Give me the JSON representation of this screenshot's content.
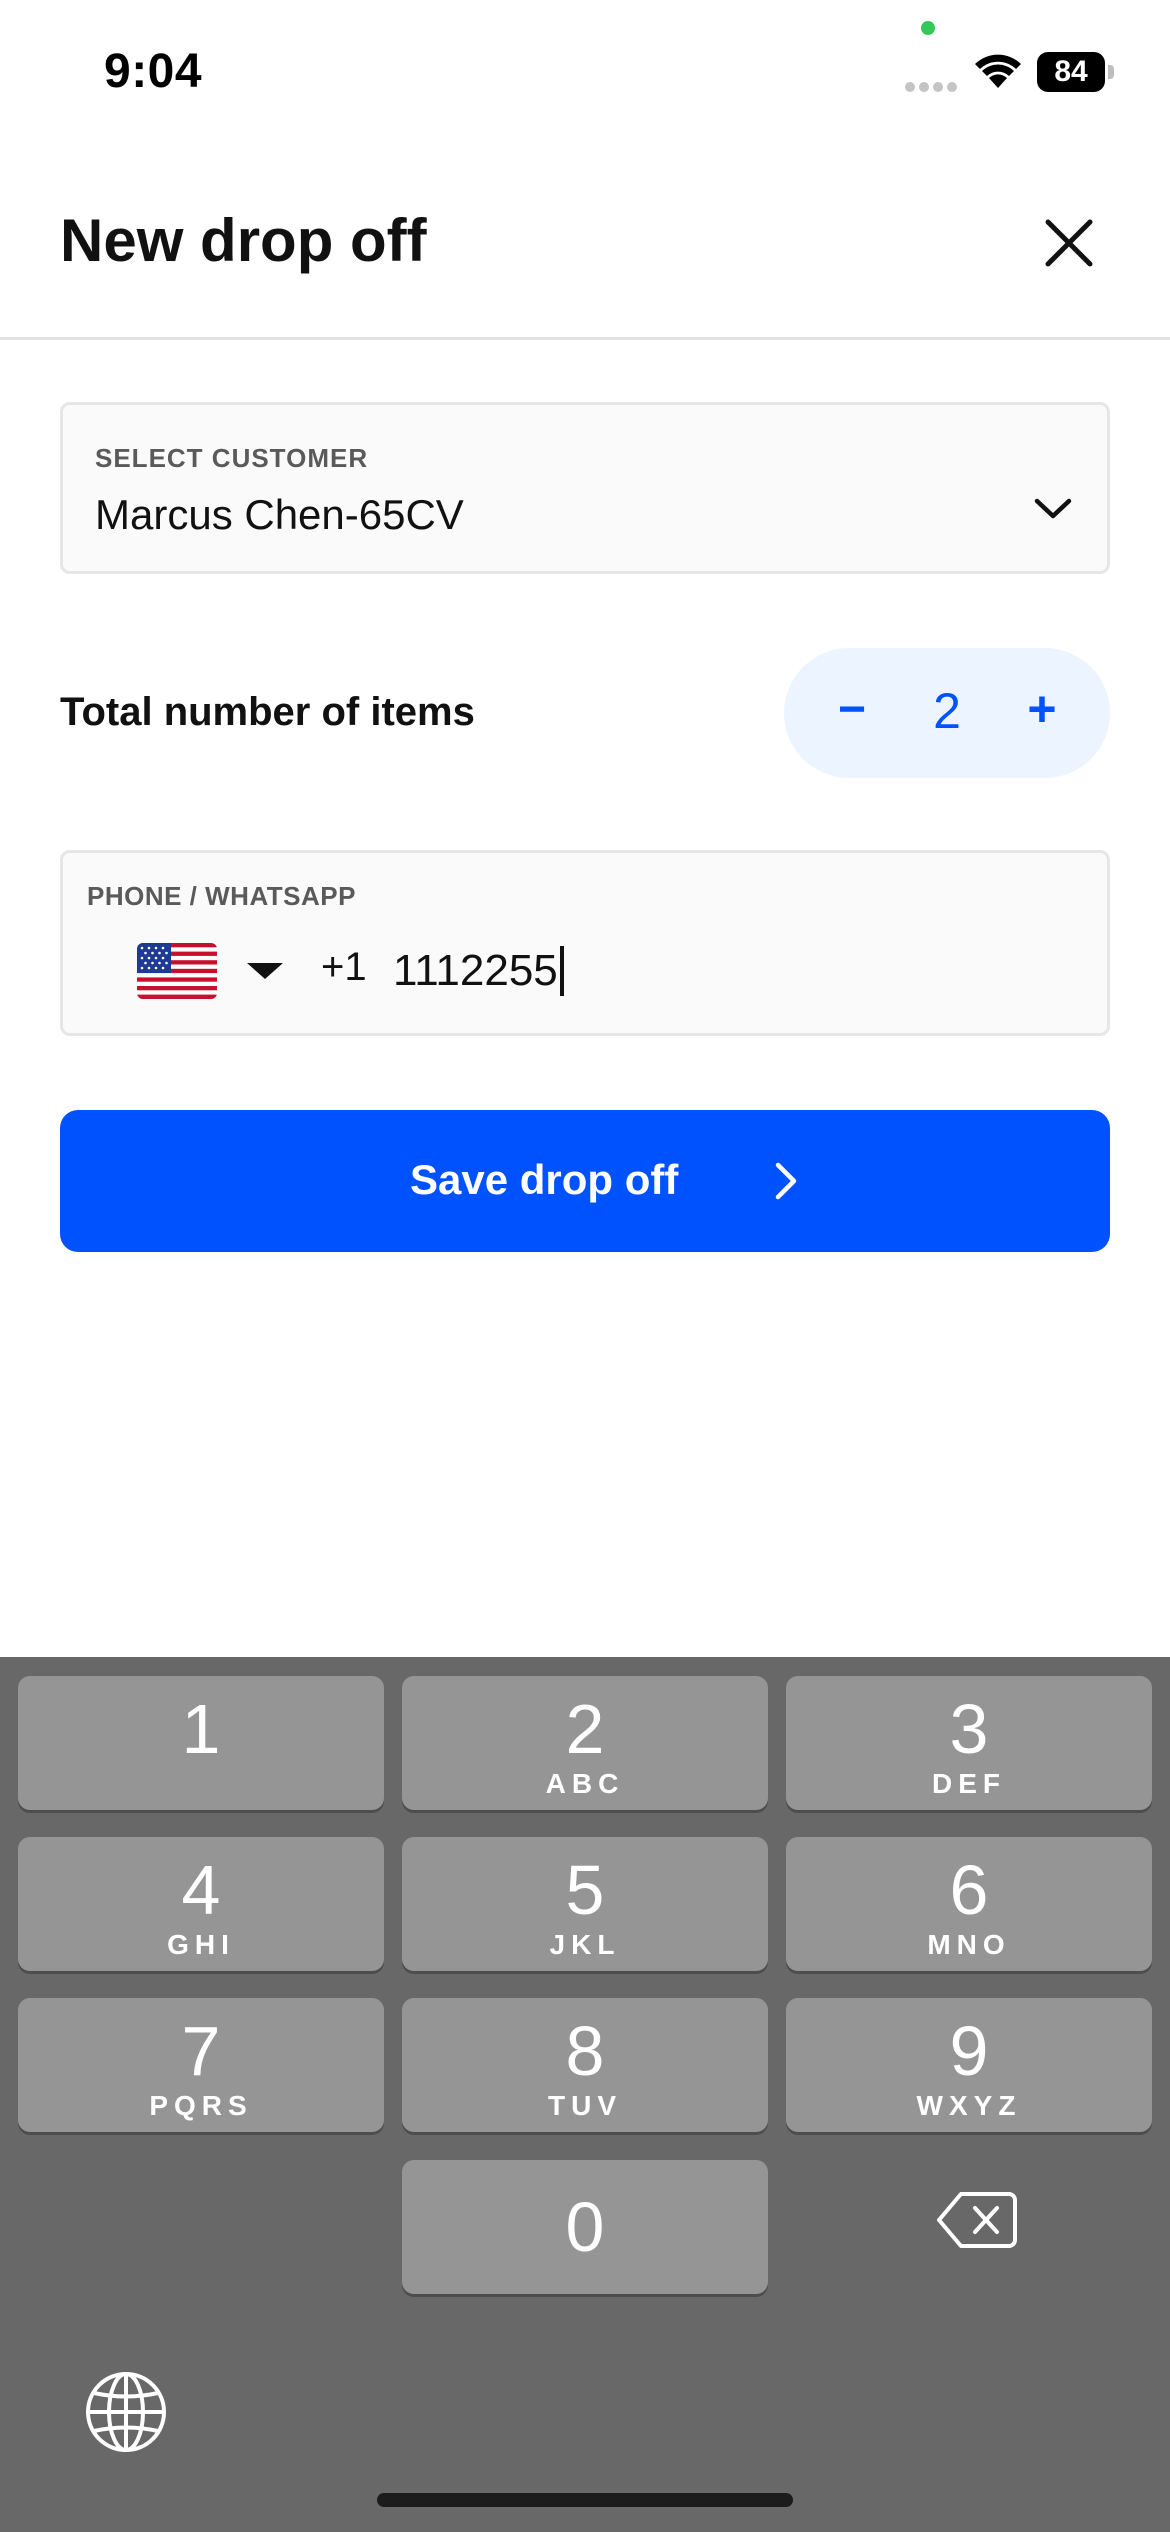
{
  "status_bar": {
    "time": "9:04",
    "battery": "84"
  },
  "header": {
    "title": "New drop off",
    "close_icon": "close-icon"
  },
  "customer": {
    "label": "SELECT CUSTOMER",
    "value": "Marcus Chen-65CV",
    "icon": "chevron-down-icon"
  },
  "items": {
    "label": "Total number of items",
    "count": "2",
    "minus": "−",
    "plus": "+"
  },
  "phone": {
    "label": "PHONE / WHATSAPP",
    "country_flag": "us-flag-icon",
    "dial_code": "+1",
    "value": "1112255"
  },
  "save_button": {
    "label": "Save drop off",
    "icon": "chevron-right-icon"
  },
  "keyboard": {
    "keys": [
      {
        "digit": "1",
        "letters": ""
      },
      {
        "digit": "2",
        "letters": "ABC"
      },
      {
        "digit": "3",
        "letters": "DEF"
      },
      {
        "digit": "4",
        "letters": "GHI"
      },
      {
        "digit": "5",
        "letters": "JKL"
      },
      {
        "digit": "6",
        "letters": "MNO"
      },
      {
        "digit": "7",
        "letters": "PQRS"
      },
      {
        "digit": "8",
        "letters": "TUV"
      },
      {
        "digit": "9",
        "letters": "WXYZ"
      },
      {
        "digit": "0",
        "letters": ""
      }
    ],
    "delete_icon": "backspace-icon",
    "globe_icon": "globe-icon"
  },
  "colors": {
    "accent": "#0052ff",
    "stepper_bg": "#ebf4ff",
    "keyboard_bg": "#686868",
    "key_bg": "#959595"
  }
}
